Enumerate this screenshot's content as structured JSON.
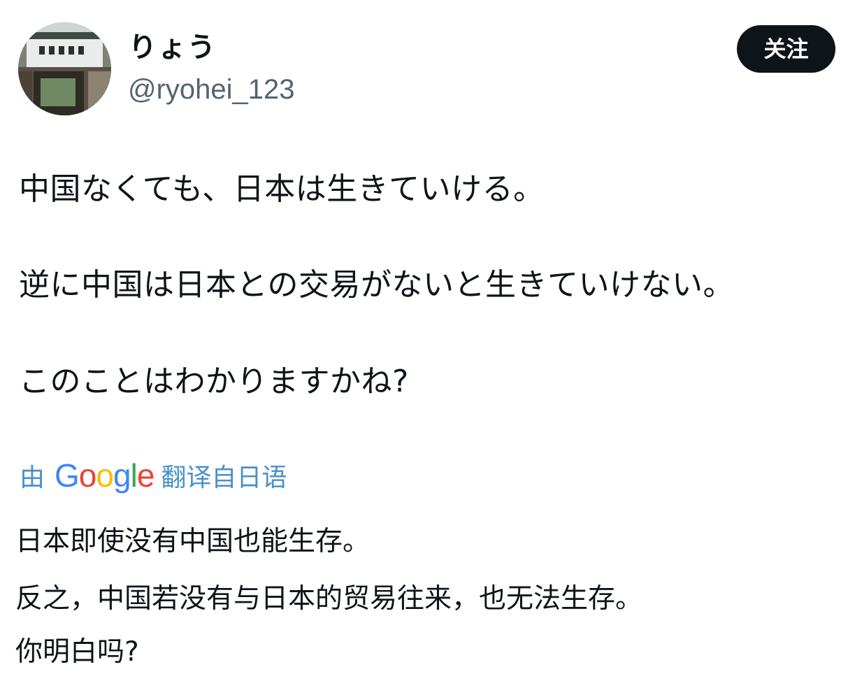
{
  "user": {
    "display_name": "りょう",
    "handle": "@ryohei_123",
    "avatar_icon": "building-gate-photo"
  },
  "follow_button": {
    "label": "关注",
    "background": "#0f1419",
    "text_color": "#ffffff"
  },
  "tweet": {
    "lines": [
      "中国なくても、日本は生きていける。",
      "逆に中国は日本との交易がないと生きていけない。",
      "このことはわかりますかね?"
    ]
  },
  "translation": {
    "prefix": "由",
    "brand": {
      "letters": [
        "G",
        "o",
        "o",
        "g",
        "l",
        "e"
      ],
      "colors": [
        "#4285F4",
        "#EA4335",
        "#FBBC05",
        "#4285F4",
        "#34A853",
        "#EA4335"
      ]
    },
    "suffix": "翻译自日语",
    "link_color": "#4a90c8",
    "lines": [
      "日本即使没有中国也能生存。",
      "反之，中国若没有与日本的贸易往来，也无法生存。",
      "你明白吗?"
    ]
  }
}
